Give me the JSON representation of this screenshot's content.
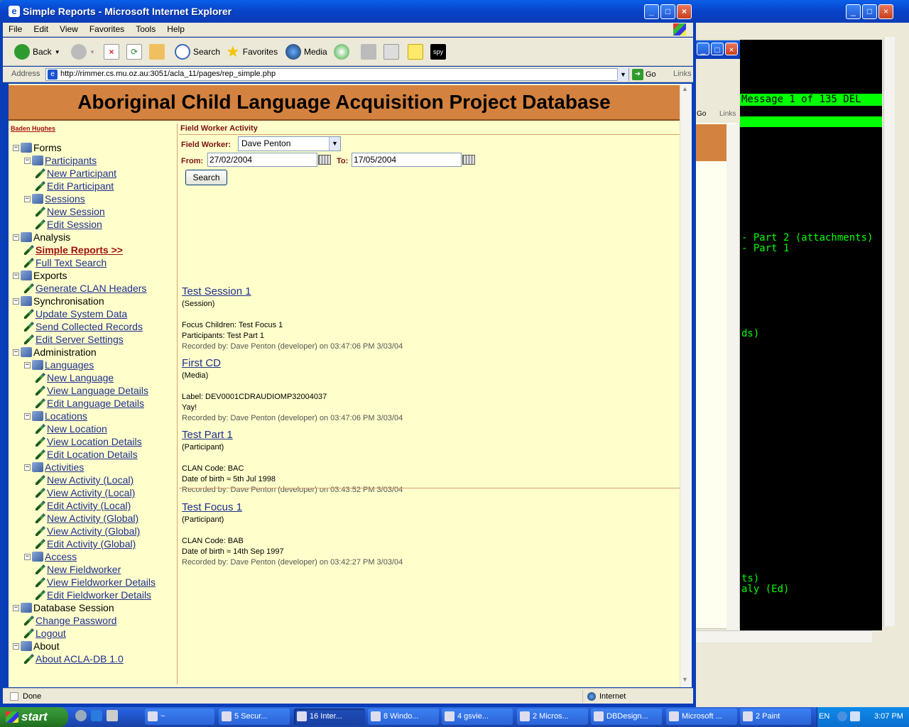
{
  "window": {
    "title": "Simple Reports - Microsoft Internet Explorer",
    "menu": [
      "File",
      "Edit",
      "View",
      "Favorites",
      "Tools",
      "Help"
    ],
    "toolbar": {
      "back": "Back",
      "search": "Search",
      "favorites": "Favorites",
      "media": "Media"
    },
    "address_label": "Address",
    "url": "http://rimmer.cs.mu.oz.au:3051/acla_11/pages/rep_simple.php",
    "go": "Go",
    "links": "Links",
    "status": "Done",
    "zone": "Internet"
  },
  "page": {
    "banner": "Aboriginal Child Language Acquisition Project Database",
    "user_link": "Baden Hughes",
    "section_title": "Field Worker Activity",
    "fieldworker_label": "Field Worker:",
    "fieldworker_value": "Dave Penton",
    "from_label": "From:",
    "from_value": "27/02/2004",
    "to_label": "To:",
    "to_value": "17/05/2004",
    "search_button": "Search"
  },
  "nav": [
    {
      "label": "Forms",
      "level": 0,
      "kind": "folder"
    },
    {
      "label": "Participants",
      "level": 1,
      "kind": "folder-link"
    },
    {
      "label": "New Participant",
      "level": 2,
      "kind": "item"
    },
    {
      "label": "Edit Participant",
      "level": 2,
      "kind": "item"
    },
    {
      "label": "Sessions",
      "level": 1,
      "kind": "folder-link"
    },
    {
      "label": "New Session",
      "level": 2,
      "kind": "item"
    },
    {
      "label": "Edit Session",
      "level": 2,
      "kind": "item"
    },
    {
      "label": "Analysis",
      "level": 0,
      "kind": "folder"
    },
    {
      "label": "Simple Reports >>",
      "level": 1,
      "kind": "current"
    },
    {
      "label": "Full Text Search",
      "level": 1,
      "kind": "item"
    },
    {
      "label": "Exports",
      "level": 0,
      "kind": "folder"
    },
    {
      "label": "Generate CLAN Headers",
      "level": 1,
      "kind": "item"
    },
    {
      "label": "Synchronisation",
      "level": 0,
      "kind": "folder"
    },
    {
      "label": "Update System Data",
      "level": 1,
      "kind": "item"
    },
    {
      "label": "Send Collected Records",
      "level": 1,
      "kind": "item"
    },
    {
      "label": "Edit Server Settings",
      "level": 1,
      "kind": "item"
    },
    {
      "label": "Administration",
      "level": 0,
      "kind": "folder"
    },
    {
      "label": "Languages",
      "level": 1,
      "kind": "folder-link"
    },
    {
      "label": "New Language",
      "level": 2,
      "kind": "item"
    },
    {
      "label": "View Language Details",
      "level": 2,
      "kind": "item"
    },
    {
      "label": "Edit Language Details",
      "level": 2,
      "kind": "item"
    },
    {
      "label": "Locations",
      "level": 1,
      "kind": "folder-link"
    },
    {
      "label": "New Location",
      "level": 2,
      "kind": "item"
    },
    {
      "label": "View Location Details",
      "level": 2,
      "kind": "item"
    },
    {
      "label": "Edit Location Details",
      "level": 2,
      "kind": "item"
    },
    {
      "label": "Activities",
      "level": 1,
      "kind": "folder-link"
    },
    {
      "label": "New Activity (Local)",
      "level": 2,
      "kind": "item"
    },
    {
      "label": "View Activity (Local)",
      "level": 2,
      "kind": "item"
    },
    {
      "label": "Edit Activity (Local)",
      "level": 2,
      "kind": "item"
    },
    {
      "label": "New Activity (Global)",
      "level": 2,
      "kind": "item"
    },
    {
      "label": "View Activity (Global)",
      "level": 2,
      "kind": "item"
    },
    {
      "label": "Edit Activity (Global)",
      "level": 2,
      "kind": "item"
    },
    {
      "label": "Access",
      "level": 1,
      "kind": "folder-link"
    },
    {
      "label": "New Fieldworker",
      "level": 2,
      "kind": "item"
    },
    {
      "label": "View Fieldworker Details",
      "level": 2,
      "kind": "item"
    },
    {
      "label": "Edit Fieldworker Details",
      "level": 2,
      "kind": "item"
    },
    {
      "label": "Database Session",
      "level": 0,
      "kind": "folder"
    },
    {
      "label": "Change Password",
      "level": 1,
      "kind": "item"
    },
    {
      "label": "Logout",
      "level": 1,
      "kind": "item"
    },
    {
      "label": "About",
      "level": 0,
      "kind": "folder"
    },
    {
      "label": "About ACLA-DB 1.0",
      "level": 1,
      "kind": "item"
    }
  ],
  "records": [
    {
      "title": "Test Session 1",
      "type": "(Session)",
      "lines": [
        "Focus Children: Test Focus 1",
        "Participants: Test Part 1"
      ],
      "recorded": "Recorded by: Dave Penton (developer) on 03:47:06 PM 3/03/04"
    },
    {
      "title": "First CD",
      "type": "(Media)",
      "lines": [
        "Label: DEV0001CDRAUDIOMP32004037",
        "Yay!"
      ],
      "recorded": "Recorded by: Dave Penton (developer) on 03:47:06 PM 3/03/04"
    },
    {
      "title": "Test Part 1",
      "type": "(Participant)",
      "lines": [
        "CLAN Code: BAC",
        "Date of birth ≈ 5th Jul 1998"
      ],
      "recorded": "Recorded by: Dave Penton (developer) on 03:43:52 PM 3/03/04"
    },
    {
      "title": "Test Focus 1",
      "type": "(Participant)",
      "lines": [
        "CLAN Code: BAB",
        "Date of birth ≈ 14th Sep 1997"
      ],
      "recorded": "Recorded by: Dave Penton (developer) on 03:42:27 PM 3/03/04"
    }
  ],
  "background": {
    "ie_go": "Go",
    "ie_links": "Links",
    "terminal": [
      "Message 1 of 135 DEL",
      "",
      "- Part 2 (attachments)",
      "- Part 1",
      "ds)",
      "ts)",
      "aly (Ed)"
    ]
  },
  "taskbar": {
    "start": "start",
    "tasks": [
      "~",
      "5 Secur...",
      "16 Inter...",
      "8 Windo...",
      "4 gsvie...",
      "2 Micros...",
      "DBDesign...",
      "Microsoft ...",
      "2 Paint"
    ],
    "lang": "EN",
    "clock": "3:07 PM"
  },
  "colors": {
    "banner": "#d4823f",
    "page_bg": "#ffffcc",
    "link": "#1f2f8f",
    "current_link": "#a01010",
    "terminal_green": "#00ff00"
  }
}
